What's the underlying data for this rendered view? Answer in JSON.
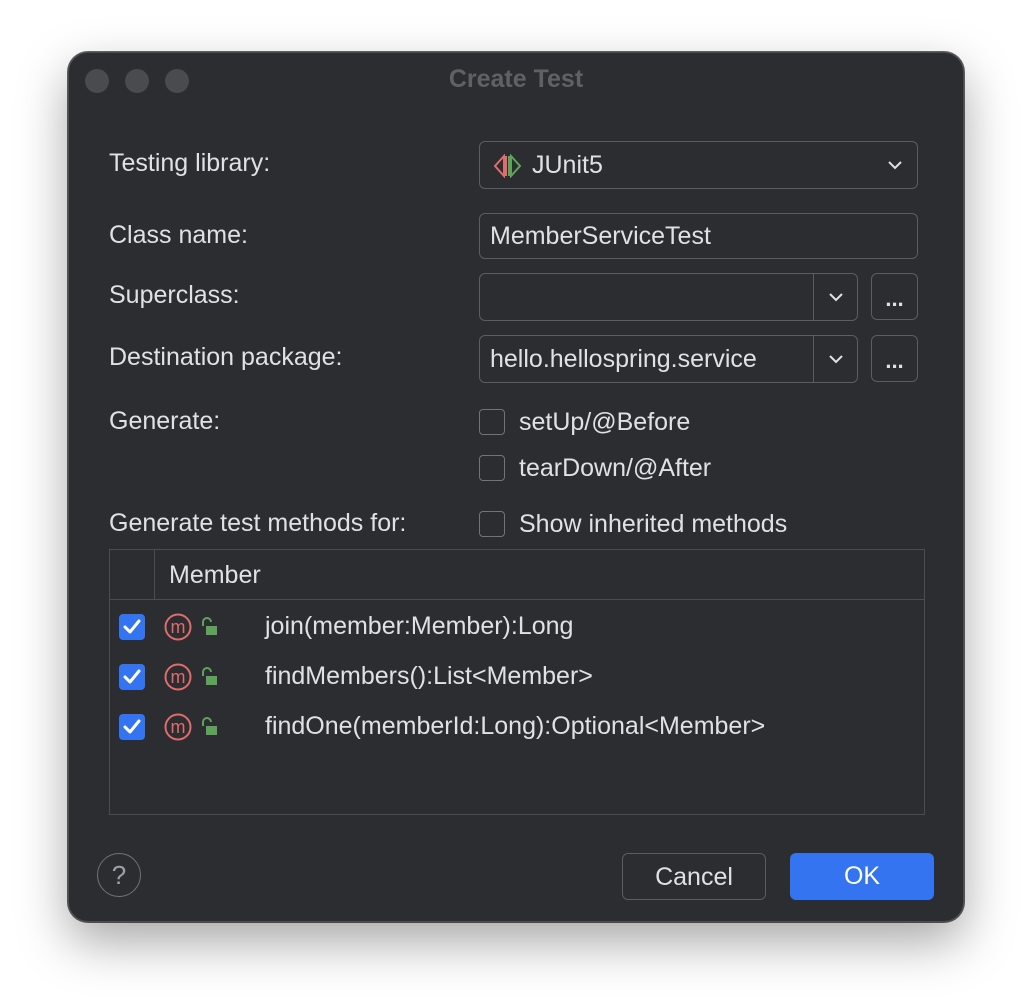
{
  "window": {
    "title": "Create Test"
  },
  "form": {
    "testing_library_label": "Testing library:",
    "testing_library_value": "JUnit5",
    "class_name_label": "Class name:",
    "class_name_value": "MemberServiceTest",
    "superclass_label": "Superclass:",
    "superclass_value": "",
    "destination_package_label": "Destination package:",
    "destination_package_value": "hello.hellospring.service",
    "browse_label": "...",
    "generate_label": "Generate:",
    "setup_label": "setUp/@Before",
    "setup_checked": false,
    "teardown_label": "tearDown/@After",
    "teardown_checked": false,
    "generate_methods_label": "Generate test methods for:",
    "show_inherited_label": "Show inherited methods",
    "show_inherited_checked": false
  },
  "table": {
    "header": "Member",
    "rows": [
      {
        "signature": "join(member:Member):Long",
        "checked": true
      },
      {
        "signature": "findMembers():List<Member>",
        "checked": true
      },
      {
        "signature": "findOne(memberId:Long):Optional<Member>",
        "checked": true
      }
    ]
  },
  "footer": {
    "help_label": "?",
    "cancel_label": "Cancel",
    "ok_label": "OK"
  },
  "colors": {
    "background": "#2b2d30",
    "accent": "#3574f0",
    "method_icon": "#e06c6c",
    "lock_icon": "#5fa35a",
    "text": "#dfe1e5"
  },
  "icons": {
    "junit": "junit-icon",
    "method": "method-icon",
    "access": "unlocked-icon",
    "dropdown": "chevron-down-icon"
  }
}
